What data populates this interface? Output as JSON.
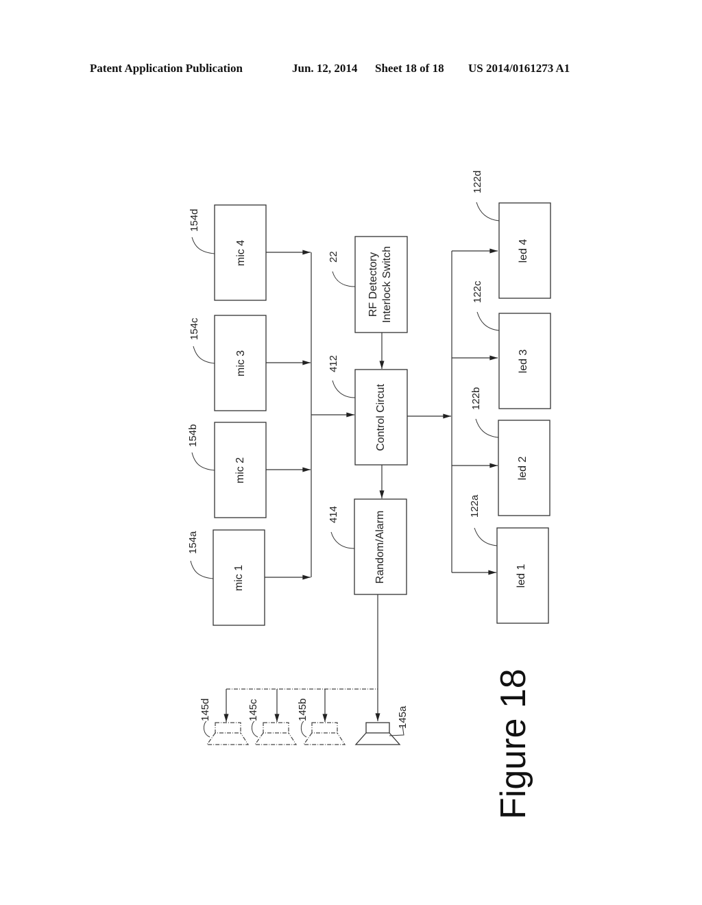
{
  "header": {
    "publication": "Patent Application Publication",
    "date": "Jun. 12, 2014",
    "sheet": "Sheet 18 of 18",
    "number": "US 2014/0161273 A1"
  },
  "figure": {
    "caption": "Figure 18",
    "mics": [
      {
        "label": "mic 1",
        "ref": "154a"
      },
      {
        "label": "mic 2",
        "ref": "154b"
      },
      {
        "label": "mic 3",
        "ref": "154c"
      },
      {
        "label": "mic 4",
        "ref": "154d"
      }
    ],
    "rf_switch": {
      "line1": "RF Detectory",
      "line2": "Interlock Switch",
      "ref": "22"
    },
    "control": {
      "label": "Control Circut",
      "ref": "412"
    },
    "alarm": {
      "label": "Random/Alarm",
      "ref": "414"
    },
    "leds": [
      {
        "label": "led 1",
        "ref": "122a"
      },
      {
        "label": "led 2",
        "ref": "122b"
      },
      {
        "label": "led 3",
        "ref": "122c"
      },
      {
        "label": "led 4",
        "ref": "122d"
      }
    ],
    "speakers": [
      {
        "ref": "145a",
        "style": "solid"
      },
      {
        "ref": "145b",
        "style": "dashed"
      },
      {
        "ref": "145c",
        "style": "dashed"
      },
      {
        "ref": "145d",
        "style": "dashed"
      }
    ]
  }
}
